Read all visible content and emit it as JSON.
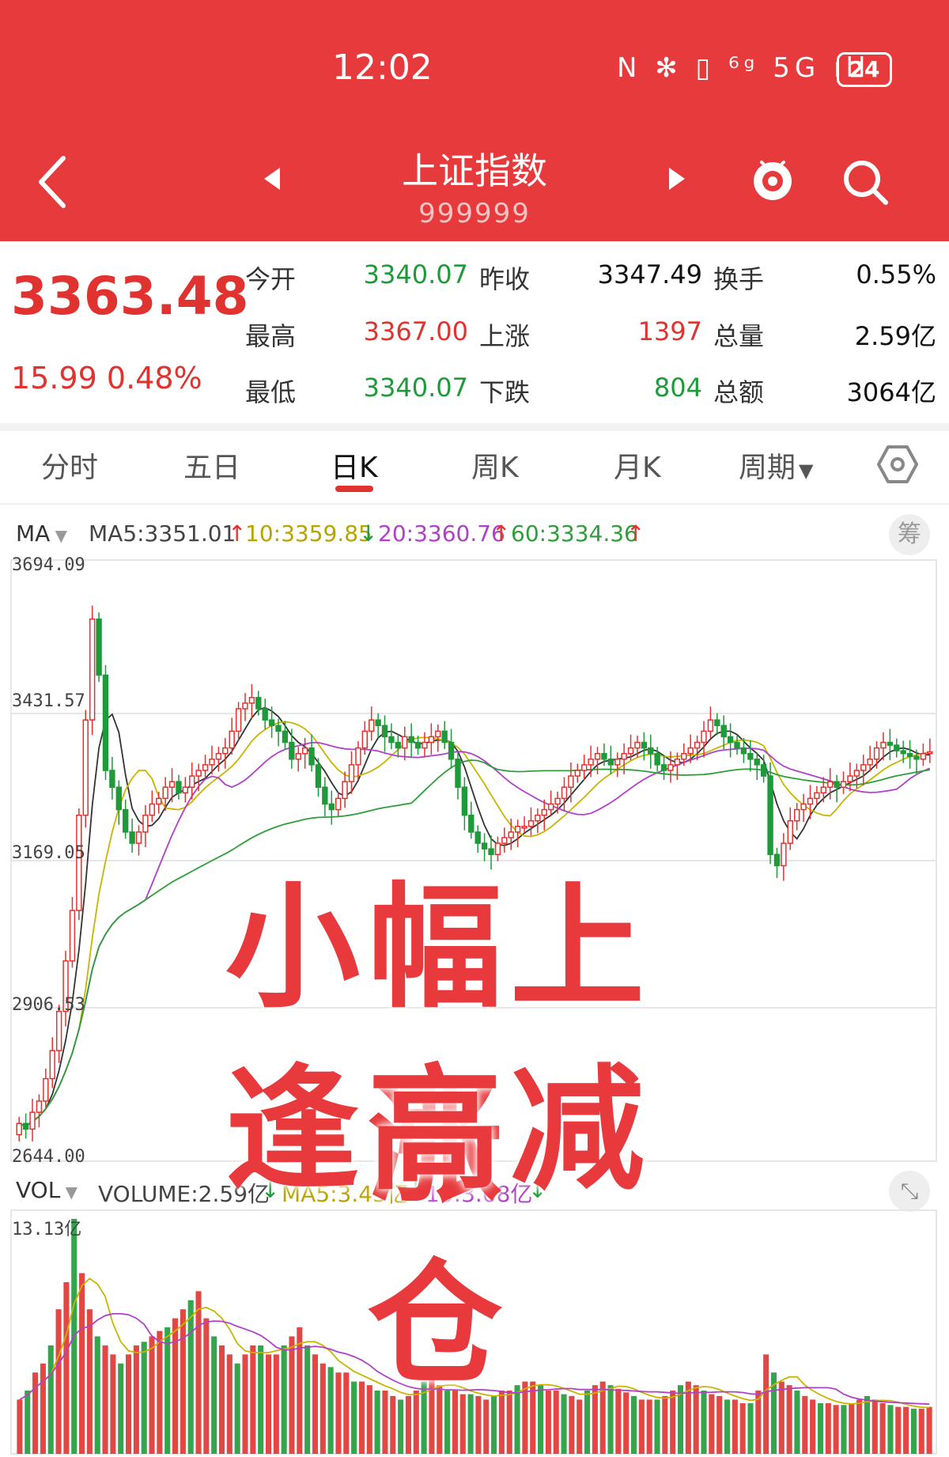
{
  "status_bar": {
    "time": "12:02",
    "icons": "N ✻ ▯ ⁶ᵍ 5G ıll",
    "battery": "24"
  },
  "header": {
    "title": "上证指数",
    "code": "999999"
  },
  "quote": {
    "price": "3363.48",
    "change": "15.99",
    "change_pct": "0.48%",
    "rows": [
      {
        "l1": "今开",
        "v1": "3340.07",
        "l2": "昨收",
        "v2": "3347.49",
        "l3": "换手",
        "v3": "0.55%"
      },
      {
        "l1": "最高",
        "v1": "3367.00",
        "l2": "上涨",
        "v2": "1397",
        "l3": "总量",
        "v3": "2.59亿"
      },
      {
        "l1": "最低",
        "v1": "3340.07",
        "l2": "下跌",
        "v2": "804",
        "l3": "总额",
        "v3": "3064亿"
      }
    ]
  },
  "tabs": [
    "分时",
    "五日",
    "日K",
    "周K",
    "月K",
    "周期"
  ],
  "active_tab": "日K",
  "ma_row": {
    "selector": "MA",
    "ma5": "MA5:3351.01",
    "ma10": "10:3359.85",
    "ma20": "20:3360.76",
    "ma60": "60:3334.36",
    "chip": "筹"
  },
  "vol_row": {
    "selector": "VOL",
    "volume": "VOLUME:2.59亿",
    "ma5": "MA5:3.45亿",
    "ma10": "10:3.68亿"
  },
  "overlay": {
    "line1": "小幅上涨",
    "line2": "逢高减仓"
  },
  "colors": {
    "up": "#e0332f",
    "down": "#1e9a3a",
    "ma5": "#333333",
    "ma10": "#c9b400",
    "ma20": "#b040c8",
    "ma60": "#2f9e3a",
    "header": "#e63a3c"
  },
  "chart_data": [
    {
      "type": "candlestick",
      "title": "",
      "y_ticks": [
        "3694.09",
        "3431.57",
        "3169.05",
        "2906.53",
        "2644.00"
      ],
      "ylim": [
        2644.0,
        3694.09
      ],
      "series_close": [
        2700,
        2690,
        2720,
        2740,
        2780,
        2830,
        2900,
        2990,
        3080,
        3250,
        3420,
        3600,
        3500,
        3330,
        3300,
        3260,
        3220,
        3200,
        3220,
        3250,
        3270,
        3280,
        3300,
        3310,
        3290,
        3300,
        3320,
        3330,
        3340,
        3350,
        3360,
        3370,
        3400,
        3440,
        3450,
        3460,
        3440,
        3420,
        3410,
        3400,
        3380,
        3350,
        3360,
        3370,
        3340,
        3300,
        3270,
        3260,
        3280,
        3310,
        3340,
        3370,
        3400,
        3420,
        3410,
        3390,
        3380,
        3370,
        3390,
        3380,
        3370,
        3380,
        3390,
        3400,
        3380,
        3350,
        3300,
        3250,
        3220,
        3200,
        3190,
        3180,
        3200,
        3210,
        3220,
        3230,
        3230,
        3240,
        3250,
        3260,
        3270,
        3280,
        3300,
        3320,
        3330,
        3340,
        3350,
        3360,
        3350,
        3340,
        3350,
        3360,
        3370,
        3380,
        3370,
        3360,
        3340,
        3330,
        3340,
        3350,
        3360,
        3370,
        3380,
        3400,
        3420,
        3410,
        3390,
        3380,
        3370,
        3360,
        3350,
        3340,
        3320,
        3180,
        3160,
        3200,
        3240,
        3260,
        3270,
        3280,
        3290,
        3300,
        3310,
        3300,
        3310,
        3320,
        3330,
        3340,
        3350,
        3370,
        3380,
        3375,
        3365,
        3360,
        3355,
        3350,
        3360,
        3363
      ]
    },
    {
      "type": "bar",
      "title": "",
      "y_ticks": [
        "13.13亿"
      ],
      "ylim": [
        0,
        13.13
      ],
      "values": [
        3.0,
        3.5,
        4.5,
        5.0,
        6.0,
        8.0,
        9.5,
        13.0,
        10.0,
        8.0,
        6.5,
        6.0,
        5.5,
        5.0,
        5.5,
        6.0,
        6.2,
        6.5,
        6.8,
        7.0,
        7.5,
        8.0,
        8.5,
        9.0,
        7.5,
        6.5,
        6.0,
        5.5,
        5.0,
        5.5,
        6.0,
        6.0,
        5.5,
        5.5,
        6.0,
        6.5,
        7.0,
        6.0,
        5.5,
        5.0,
        4.8,
        4.5,
        4.5,
        4.0,
        4.0,
        3.8,
        3.5,
        3.5,
        3.2,
        3.0,
        3.2,
        3.5,
        4.0,
        4.2,
        3.8,
        3.5,
        3.5,
        3.3,
        3.3,
        3.2,
        3.0,
        3.2,
        3.5,
        3.5,
        3.8,
        4.0,
        4.0,
        3.8,
        3.5,
        3.5,
        3.3,
        3.2,
        3.0,
        3.5,
        3.8,
        4.0,
        3.8,
        3.6,
        3.4,
        3.2,
        3.0,
        3.0,
        3.0,
        3.2,
        3.5,
        3.8,
        4.0,
        3.8,
        3.5,
        3.3,
        3.2,
        3.0,
        3.0,
        2.8,
        2.8,
        3.5,
        5.5,
        4.5,
        4.0,
        3.8,
        3.5,
        3.2,
        3.0,
        2.8,
        2.8,
        2.7,
        2.7,
        2.8,
        3.0,
        3.2,
        3.0,
        2.8,
        2.7,
        2.6,
        2.6,
        2.5,
        2.5,
        2.6
      ]
    }
  ]
}
